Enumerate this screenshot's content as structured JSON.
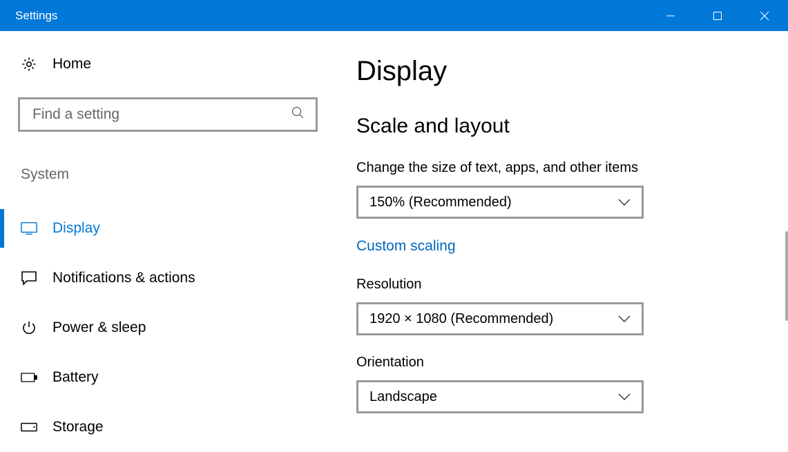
{
  "titlebar": {
    "title": "Settings"
  },
  "sidebar": {
    "home_label": "Home",
    "search_placeholder": "Find a setting",
    "category_label": "System",
    "items": [
      {
        "label": "Display",
        "active": true
      },
      {
        "label": "Notifications & actions",
        "active": false
      },
      {
        "label": "Power & sleep",
        "active": false
      },
      {
        "label": "Battery",
        "active": false
      },
      {
        "label": "Storage",
        "active": false
      }
    ]
  },
  "main": {
    "page_title": "Display",
    "section_title": "Scale and layout",
    "scale": {
      "label": "Change the size of text, apps, and other items",
      "value": "150% (Recommended)"
    },
    "custom_scaling_link": "Custom scaling",
    "resolution": {
      "label": "Resolution",
      "value": "1920 × 1080 (Recommended)"
    },
    "orientation": {
      "label": "Orientation",
      "value": "Landscape"
    }
  }
}
